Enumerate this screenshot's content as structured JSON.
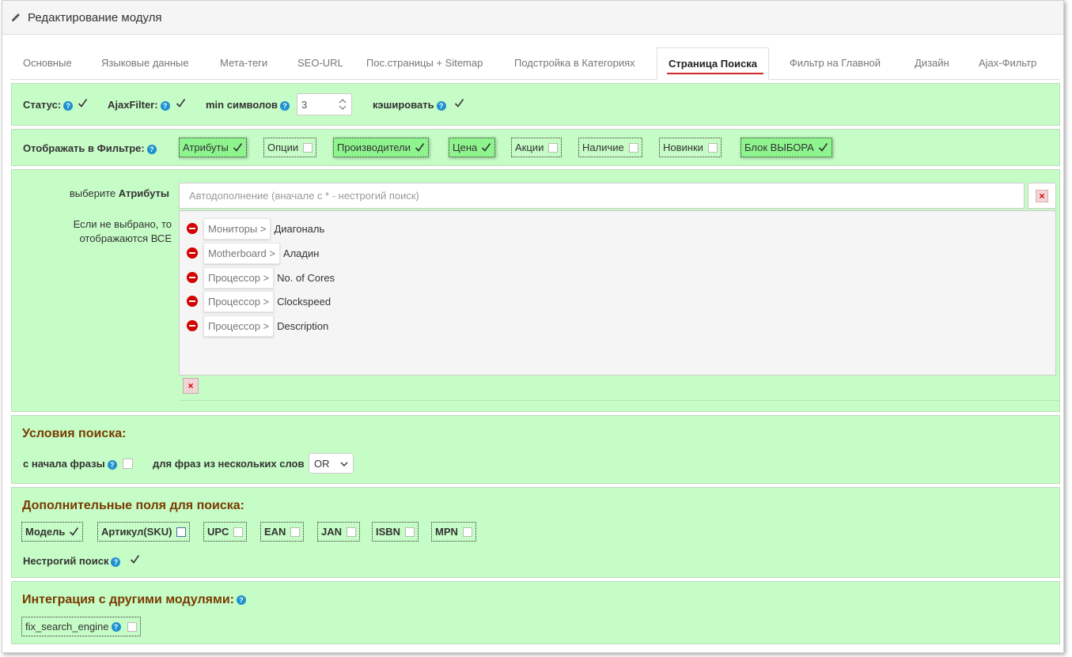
{
  "header": {
    "title": "Редактирование модуля",
    "icon": "pencil-icon"
  },
  "tabs": [
    {
      "label": "Основные"
    },
    {
      "label": "Языковые данные"
    },
    {
      "label": "Мета-теги"
    },
    {
      "label": "SEO-URL"
    },
    {
      "label": "Пос.страницы + Sitemap"
    },
    {
      "label": "Подстройка в Категориях"
    },
    {
      "label": "Страница Поиска",
      "active": true
    },
    {
      "label": "Фильтр на Главной"
    },
    {
      "label": "Дизайн"
    },
    {
      "label": "Ajax-Фильтр"
    }
  ],
  "settings": {
    "status_label": "Статус:",
    "status_checked": true,
    "ajax_label": "AjaxFilter:",
    "ajax_checked": true,
    "min_label": "min символов",
    "min_value": "3",
    "cache_label": "кэшировать",
    "cache_checked": true
  },
  "filter_display": {
    "label": "Отображать в Фильтре:",
    "items": [
      {
        "label": "Атрибуты",
        "checked": true
      },
      {
        "label": "Опции",
        "checked": false
      },
      {
        "label": "Производители",
        "checked": true
      },
      {
        "label": "Цена",
        "checked": true
      },
      {
        "label": "Акции",
        "checked": false
      },
      {
        "label": "Наличие",
        "checked": false
      },
      {
        "label": "Новинки",
        "checked": false
      },
      {
        "label": "Блок ВЫБОРА",
        "checked": true
      }
    ]
  },
  "attributes": {
    "label_prefix": "выберите",
    "label_bold": "Атрибуты",
    "hint": "Если не выбрано, то отображаются ВСЕ",
    "placeholder": "Автодополнение (вначале с * - нестрогий поиск)",
    "list": [
      {
        "group": "Мониторы >",
        "name": "Диагональ"
      },
      {
        "group": "Motherboard >",
        "name": "Аладин"
      },
      {
        "group": "Процессор >",
        "name": "No. of Cores"
      },
      {
        "group": "Процессор >",
        "name": "Clockspeed"
      },
      {
        "group": "Процессор >",
        "name": "Description"
      }
    ],
    "clear_symbol": "×"
  },
  "conditions": {
    "title": "Условия поиска:",
    "phrase_start_label": "с начала фразы",
    "phrase_start_checked": false,
    "multi_label": "для фраз из нескольких слов",
    "multi_value": "OR"
  },
  "extra_fields": {
    "title": "Дополнительные поля для поиска:",
    "items": [
      {
        "label": "Модель",
        "checked": true
      },
      {
        "label": "Артикул(SKU)",
        "checked": false
      },
      {
        "label": "UPC",
        "checked": false
      },
      {
        "label": "EAN",
        "checked": false
      },
      {
        "label": "JAN",
        "checked": false
      },
      {
        "label": "ISBN",
        "checked": false
      },
      {
        "label": "MPN",
        "checked": false
      }
    ],
    "fuzzy_label": "Нестрогий поиск",
    "fuzzy_checked": true
  },
  "integration": {
    "title": "Интеграция с другими модулями:",
    "item_label": "fix_search_engine",
    "item_checked": false
  },
  "colors": {
    "section_bg": "#c6fcc6",
    "checked_bg": "#8ef48e",
    "title": "#7a3b00",
    "help": "#1e91cf",
    "active_tab_underline": "#cf2b2b"
  },
  "help_symbol": "?"
}
